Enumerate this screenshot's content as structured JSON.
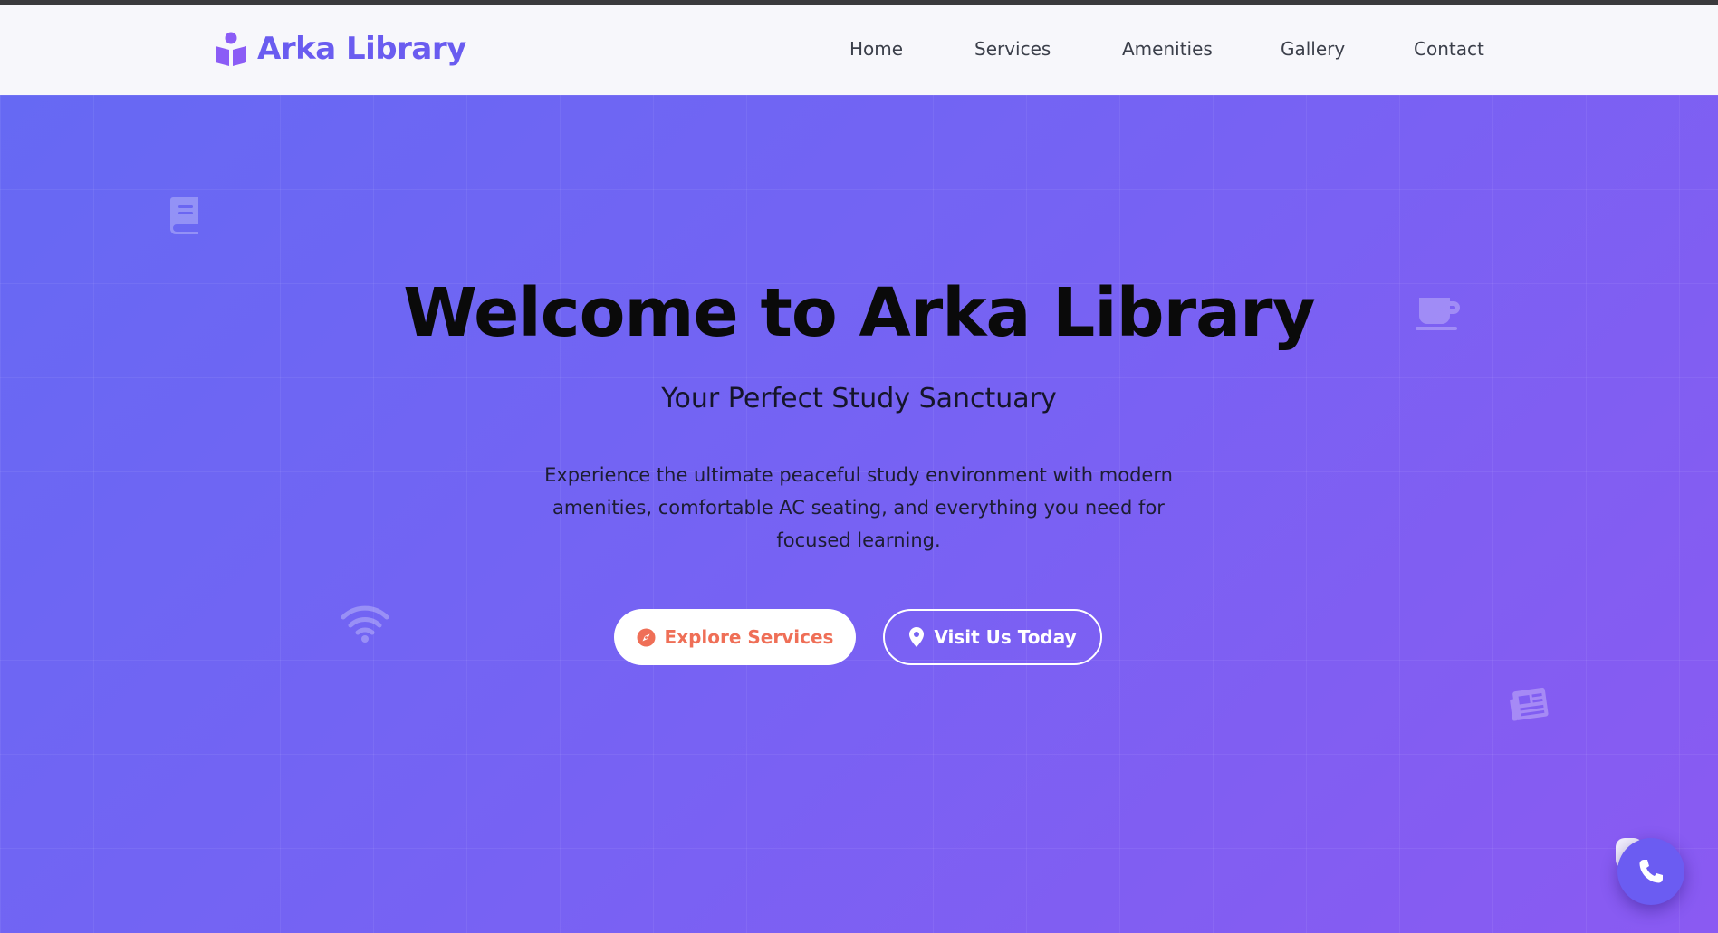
{
  "brand": {
    "name": "Arka Library",
    "icon": "reading-person-icon",
    "color": "#6a5cf0"
  },
  "nav": {
    "items": [
      {
        "label": "Home"
      },
      {
        "label": "Services"
      },
      {
        "label": "Amenities"
      },
      {
        "label": "Gallery"
      },
      {
        "label": "Contact"
      }
    ]
  },
  "hero": {
    "title": "Welcome to Arka Library",
    "subtitle": "Your Perfect Study Sanctuary",
    "description": "Experience the ultimate peaceful study environment with modern amenities, comfortable AC seating, and everything you need for focused learning.",
    "buttons": [
      {
        "label": "Explore Services",
        "icon": "compass-icon"
      },
      {
        "label": "Visit Us Today",
        "icon": "map-pin-icon"
      }
    ],
    "decorative_icons": [
      "book-icon",
      "coffee-icon",
      "wifi-icon",
      "newspaper-icon"
    ]
  },
  "floating_action": {
    "icon": "phone-icon"
  },
  "colors": {
    "accent": "#6a5cf0",
    "hero_gradient_start": "#6669f3",
    "hero_gradient_end": "#8a5af2",
    "explore_button_text": "#ef6f57"
  }
}
